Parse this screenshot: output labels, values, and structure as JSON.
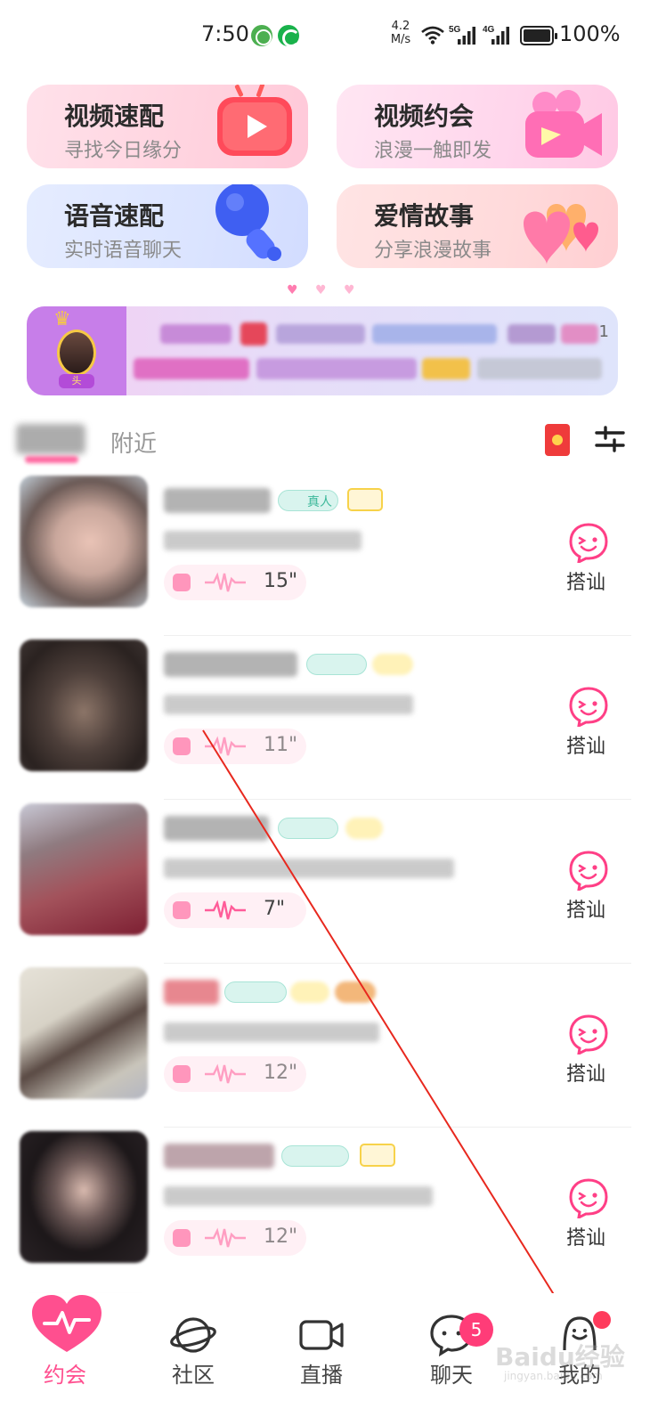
{
  "status_bar": {
    "time": "7:50",
    "net_speed": "4.2",
    "net_speed_unit": "M/s",
    "sig1_label": "5G",
    "sig2_label": "4G",
    "battery_pct": "100%"
  },
  "features": [
    {
      "title": "视频速配",
      "subtitle": "寻找今日缘分",
      "icon": "play-tv-icon"
    },
    {
      "title": "视频约会",
      "subtitle": "浪漫一触即发",
      "icon": "video-camera-icon"
    },
    {
      "title": "语音速配",
      "subtitle": "实时语音聊天",
      "icon": "microphone-icon"
    },
    {
      "title": "爱情故事",
      "subtitle": "分享浪漫故事",
      "icon": "hearts-icon"
    }
  ],
  "carousel_dots": "3",
  "banner": {
    "avatar_tag": "头",
    "number": "1"
  },
  "tabs": {
    "nearby": "附近"
  },
  "users": [
    {
      "duration": "15\"",
      "badge_text": "真人",
      "chat_label": "搭讪"
    },
    {
      "duration": "11\"",
      "badge_text": "",
      "chat_label": "搭讪"
    },
    {
      "duration": "7\"",
      "badge_text": "",
      "chat_label": "搭讪"
    },
    {
      "duration": "12\"",
      "badge_text": "",
      "chat_label": "搭讪"
    },
    {
      "duration": "12\"",
      "badge_text": "",
      "chat_label": "搭讪"
    }
  ],
  "nav": {
    "items": [
      {
        "label": "约会",
        "icon": "heart-pulse-icon"
      },
      {
        "label": "社区",
        "icon": "planet-icon"
      },
      {
        "label": "直播",
        "icon": "live-camera-icon"
      },
      {
        "label": "聊天",
        "icon": "chat-bubble-icon"
      },
      {
        "label": "我的",
        "icon": "profile-icon"
      }
    ],
    "chat_badge": "5"
  },
  "watermark": {
    "text": "Baidu经验",
    "sub": "jingyan.baidu.com"
  },
  "colors": {
    "accent": "#ff4f8f",
    "badge": "#ff3c78",
    "annotation": "#e8281e"
  }
}
